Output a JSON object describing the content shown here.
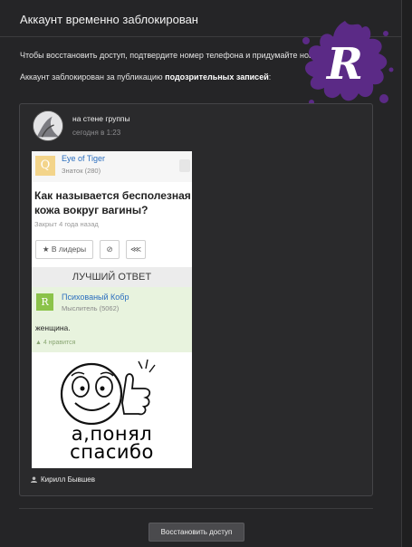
{
  "window": {
    "title": "Аккаунт временно заблокирован"
  },
  "notice": {
    "line1": "Чтобы восстановить доступ, подтвердите номер телефона и придумайте новый пароль.",
    "line2_prefix": "Аккаунт заблокирован за публикацию ",
    "line2_bold": "подозрительных записей",
    "line2_suffix": ":"
  },
  "post": {
    "source": "на стене группы",
    "date": "сегодня в 1:23",
    "author": "Кирилл Бывшев"
  },
  "qa": {
    "asker_initial": "Q",
    "asker_name": "Eye of Tiger",
    "asker_rank": "Знаток (280)",
    "question": "Как называется бесполезная кожа вокруг вагины?",
    "asked": "Закрыт 4 года назад",
    "leaders_button": "★ В лидеры",
    "block_icon": "⊘",
    "share_icon": "⋘",
    "best_answer_header": "ЛУЧШИЙ ОТВЕТ",
    "answerer_initial": "R",
    "answerer_name": "Психованый Кобр",
    "answerer_rank": "Мыслитель (5062)",
    "answer": "женщина.",
    "likes": "4 нравится"
  },
  "meme": {
    "caption_line1": "а,понял",
    "caption_line2": "спасибо"
  },
  "actions": {
    "restore_button": "Восстановить доступ"
  },
  "logo": {
    "letter": "R",
    "color": "#5b2a86"
  },
  "colors": {
    "background": "#252527",
    "link": "#2c6fbf",
    "answer_bg": "#e8f3de"
  }
}
